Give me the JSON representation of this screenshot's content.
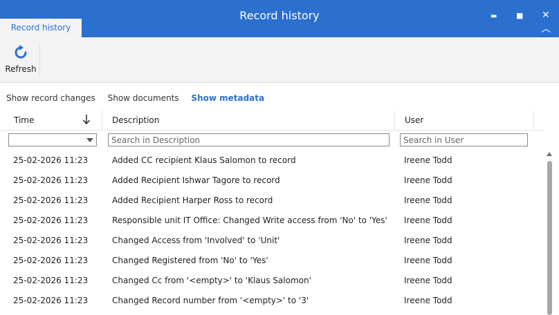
{
  "window": {
    "title": "Record history",
    "tab_label": "Record history",
    "controls": {
      "minimize": "▬",
      "maximize": "■",
      "close": "✕",
      "collapse": "︿"
    }
  },
  "toolbar": {
    "refresh_label": "Refresh",
    "refresh_icon": "refresh-icon",
    "accent": "#2b6fcf"
  },
  "view_links": [
    {
      "label": "Show record changes",
      "active": false
    },
    {
      "label": "Show documents",
      "active": false
    },
    {
      "label": "Show metadata",
      "active": true
    }
  ],
  "table": {
    "columns": {
      "time": "Time",
      "description": "Description",
      "user": "User"
    },
    "sort": {
      "column": "Time",
      "direction": "descending",
      "icon": "arrow-down-icon"
    },
    "filters": {
      "time_value": "",
      "description_placeholder": "Search in Description",
      "user_placeholder": "Search in User"
    },
    "rows": [
      {
        "time": "25-02-2026 11:23",
        "description": "Added CC recipient Klaus Salomon to record",
        "user": "Ireene Todd"
      },
      {
        "time": "25-02-2026 11:23",
        "description": "Added Recipient Ishwar Tagore to record",
        "user": "Ireene Todd"
      },
      {
        "time": "25-02-2026 11:23",
        "description": "Added Recipient Harper Ross to record",
        "user": "Ireene Todd"
      },
      {
        "time": "25-02-2026 11:23",
        "description": "Responsible unit IT Office: Changed Write access from 'No' to 'Yes'",
        "user": "Ireene Todd"
      },
      {
        "time": "25-02-2026 11:23",
        "description": "Changed Access from 'Involved' to 'Unit'",
        "user": "Ireene Todd"
      },
      {
        "time": "25-02-2026 11:23",
        "description": "Changed Registered from 'No' to 'Yes'",
        "user": "Ireene Todd"
      },
      {
        "time": "25-02-2026 11:23",
        "description": "Changed Cc from '<empty>' to 'Klaus Salomon'",
        "user": "Ireene Todd"
      },
      {
        "time": "25-02-2026 11:23",
        "description": "Changed Record number from '<empty>' to '3'",
        "user": "Ireene Todd"
      }
    ]
  }
}
